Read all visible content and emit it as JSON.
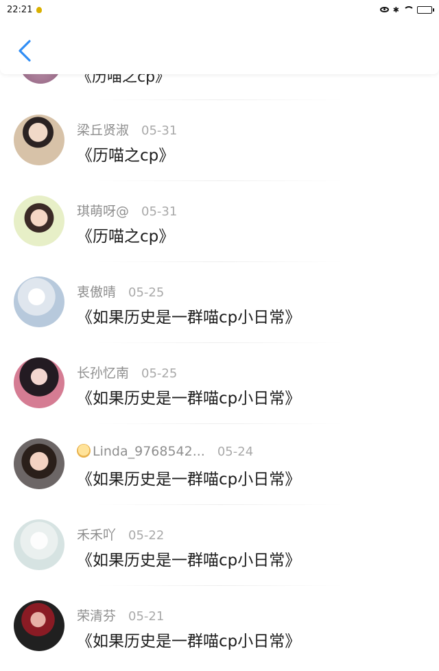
{
  "status_bar": {
    "time": "22:21"
  },
  "header": {
    "back_icon": "chevron-left-icon"
  },
  "partial_item": {
    "comment": "《历喵之cp》"
  },
  "comments": [
    {
      "name": "梁丘贤淑",
      "date": "05-31",
      "comment": "《历喵之cp》"
    },
    {
      "name": "琪萌呀@",
      "date": "05-31",
      "comment": "《历喵之cp》"
    },
    {
      "name": "衷傲晴",
      "date": "05-25",
      "comment": "《如果历史是一群喵cp小日常》"
    },
    {
      "name": "长孙忆南",
      "date": "05-25",
      "comment": "《如果历史是一群喵cp小日常》"
    },
    {
      "name": "Linda_9768542...",
      "date": "05-24",
      "comment": "《如果历史是一群喵cp小日常》"
    },
    {
      "name": "禾禾吖",
      "date": "05-22",
      "comment": "《如果历史是一群喵cp小日常》"
    },
    {
      "name": "荣清芬",
      "date": "05-21",
      "comment": "《如果历史是一群喵cp小日常》"
    }
  ],
  "colors": {
    "accent": "#2f8df5",
    "name": "#8e8e8e",
    "date": "#a9a9a9",
    "text": "#1c1c1c"
  }
}
